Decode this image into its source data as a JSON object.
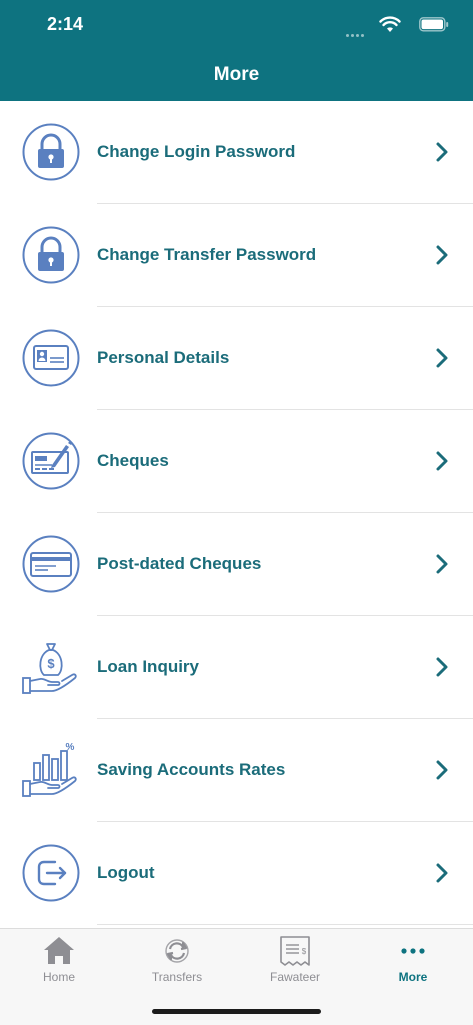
{
  "status_bar": {
    "time": "2:14"
  },
  "header": {
    "title": "More"
  },
  "menu": [
    {
      "label": "Change Login Password",
      "icon": "lock-icon"
    },
    {
      "label": "Change Transfer Password",
      "icon": "lock-icon"
    },
    {
      "label": "Personal Details",
      "icon": "id-card-icon"
    },
    {
      "label": "Cheques",
      "icon": "cheque-icon"
    },
    {
      "label": "Post-dated Cheques",
      "icon": "credit-card-icon"
    },
    {
      "label": "Loan Inquiry",
      "icon": "money-bag-hand-icon"
    },
    {
      "label": "Saving Accounts Rates",
      "icon": "savings-chart-hand-icon"
    },
    {
      "label": "Logout",
      "icon": "logout-icon"
    }
  ],
  "tabbar": {
    "tabs": [
      {
        "label": "Home",
        "icon": "home-icon",
        "active": false
      },
      {
        "label": "Transfers",
        "icon": "transfers-icon",
        "active": false
      },
      {
        "label": "Fawateer",
        "icon": "receipt-icon",
        "active": false
      },
      {
        "label": "More",
        "icon": "more-dots-icon",
        "active": true
      }
    ]
  },
  "colors": {
    "header": "#0e7380",
    "label": "#1b6c7a",
    "icon_stroke": "#5a80c0",
    "inactive_tab": "#8e8e93"
  }
}
